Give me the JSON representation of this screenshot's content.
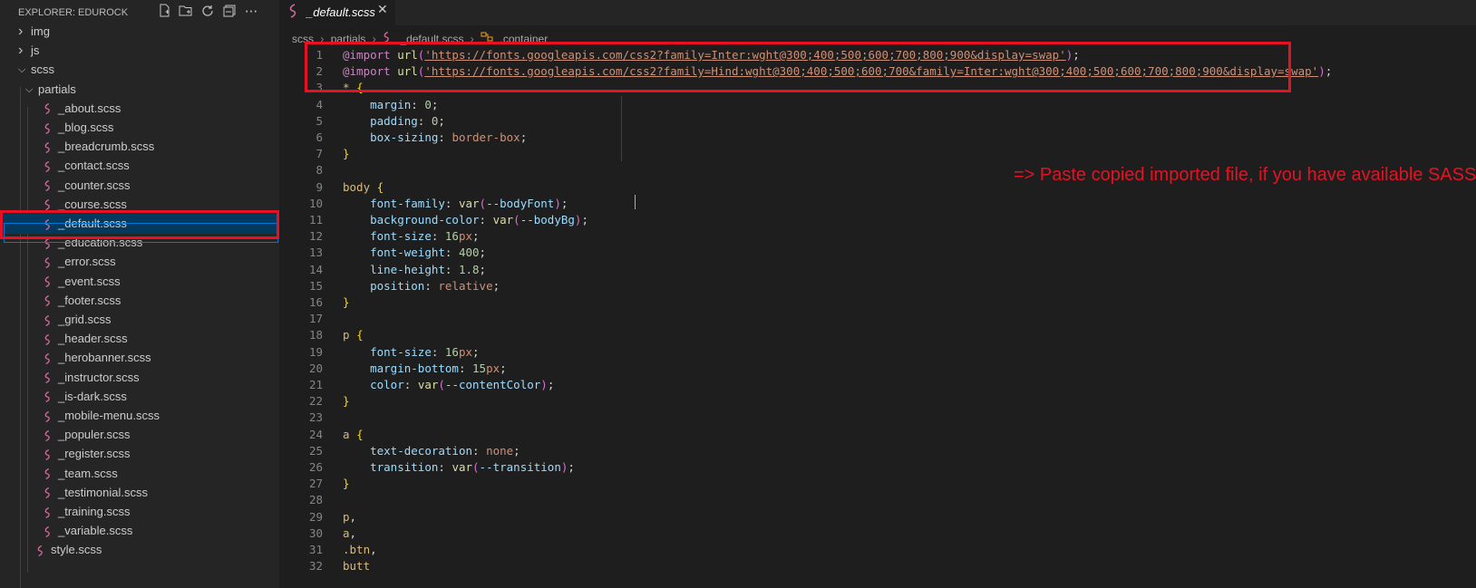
{
  "explorer": {
    "title": "EXPLORER: EDUROCK",
    "actions": [
      "new-file-icon",
      "new-folder-icon",
      "refresh-icon",
      "collapse-all-icon",
      "more-icon"
    ],
    "more_label": "···"
  },
  "tree": [
    {
      "label": "img",
      "type": "folder",
      "expanded": false,
      "depth": 0
    },
    {
      "label": "js",
      "type": "folder",
      "expanded": false,
      "depth": 0
    },
    {
      "label": "scss",
      "type": "folder",
      "expanded": true,
      "depth": 0
    },
    {
      "label": "partials",
      "type": "folder",
      "expanded": true,
      "depth": 1
    },
    {
      "label": "_about.scss",
      "type": "file",
      "depth": 2
    },
    {
      "label": "_blog.scss",
      "type": "file",
      "depth": 2
    },
    {
      "label": "_breadcrumb.scss",
      "type": "file",
      "depth": 2
    },
    {
      "label": "_contact.scss",
      "type": "file",
      "depth": 2
    },
    {
      "label": "_counter.scss",
      "type": "file",
      "depth": 2
    },
    {
      "label": "_course.scss",
      "type": "file",
      "depth": 2
    },
    {
      "label": "_default.scss",
      "type": "file",
      "depth": 2,
      "selected": true
    },
    {
      "label": "_education.scss",
      "type": "file",
      "depth": 2
    },
    {
      "label": "_error.scss",
      "type": "file",
      "depth": 2
    },
    {
      "label": "_event.scss",
      "type": "file",
      "depth": 2
    },
    {
      "label": "_footer.scss",
      "type": "file",
      "depth": 2
    },
    {
      "label": "_grid.scss",
      "type": "file",
      "depth": 2
    },
    {
      "label": "_header.scss",
      "type": "file",
      "depth": 2
    },
    {
      "label": "_herobanner.scss",
      "type": "file",
      "depth": 2
    },
    {
      "label": "_instructor.scss",
      "type": "file",
      "depth": 2
    },
    {
      "label": "_is-dark.scss",
      "type": "file",
      "depth": 2
    },
    {
      "label": "_mobile-menu.scss",
      "type": "file",
      "depth": 2
    },
    {
      "label": "_populer.scss",
      "type": "file",
      "depth": 2
    },
    {
      "label": "_register.scss",
      "type": "file",
      "depth": 2
    },
    {
      "label": "_team.scss",
      "type": "file",
      "depth": 2
    },
    {
      "label": "_testimonial.scss",
      "type": "file",
      "depth": 2
    },
    {
      "label": "_training.scss",
      "type": "file",
      "depth": 2
    },
    {
      "label": "_variable.scss",
      "type": "file",
      "depth": 2
    },
    {
      "label": "style.scss",
      "type": "file",
      "depth": 1
    }
  ],
  "tab": {
    "label": "_default.scss",
    "close": "✕"
  },
  "breadcrumb": {
    "items": [
      "scss",
      "partials",
      "_default.scss",
      ".container"
    ]
  },
  "code_lines": [
    {
      "n": "1",
      "text": "@import url('https://fonts.googleapis.com/css2?family=Inter:wght@300;400;500;600;700;800;900&display=swap');"
    },
    {
      "n": "2",
      "text": "@import url('https://fonts.googleapis.com/css2?family=Hind:wght@300;400;500;600;700&family=Inter:wght@300;400;500;600;700;800;900&display=swap');"
    },
    {
      "n": "3",
      "text": "* {"
    },
    {
      "n": "4",
      "text": "    margin: 0;"
    },
    {
      "n": "5",
      "text": "    padding: 0;"
    },
    {
      "n": "6",
      "text": "    box-sizing: border-box;"
    },
    {
      "n": "7",
      "text": "}"
    },
    {
      "n": "8",
      "text": ""
    },
    {
      "n": "9",
      "text": "body {"
    },
    {
      "n": "10",
      "text": "    font-family: var(--bodyFont);"
    },
    {
      "n": "11",
      "text": "    background-color: var(--bodyBg);"
    },
    {
      "n": "12",
      "text": "    font-size: 16px;"
    },
    {
      "n": "13",
      "text": "    font-weight: 400;"
    },
    {
      "n": "14",
      "text": "    line-height: 1.8;"
    },
    {
      "n": "15",
      "text": "    position: relative;"
    },
    {
      "n": "16",
      "text": "}"
    },
    {
      "n": "17",
      "text": ""
    },
    {
      "n": "18",
      "text": "p {"
    },
    {
      "n": "19",
      "text": "    font-size: 16px;"
    },
    {
      "n": "20",
      "text": "    margin-bottom: 15px;"
    },
    {
      "n": "21",
      "text": "    color: var(--contentColor);"
    },
    {
      "n": "22",
      "text": "}"
    },
    {
      "n": "23",
      "text": ""
    },
    {
      "n": "24",
      "text": "a {"
    },
    {
      "n": "25",
      "text": "    text-decoration: none;"
    },
    {
      "n": "26",
      "text": "    transition: var(--transition);"
    },
    {
      "n": "27",
      "text": "}"
    },
    {
      "n": "28",
      "text": ""
    },
    {
      "n": "29",
      "text": "p,"
    },
    {
      "n": "30",
      "text": "a,"
    },
    {
      "n": "31",
      "text": ".btn,"
    },
    {
      "n": "32",
      "text": "butt"
    }
  ],
  "annotation": "=> Paste copied imported file, if you have available SASS.",
  "colors": {
    "highlight_red": "#e81123",
    "sass_pink": "#cd6799",
    "selection_blue": "#04395e"
  }
}
